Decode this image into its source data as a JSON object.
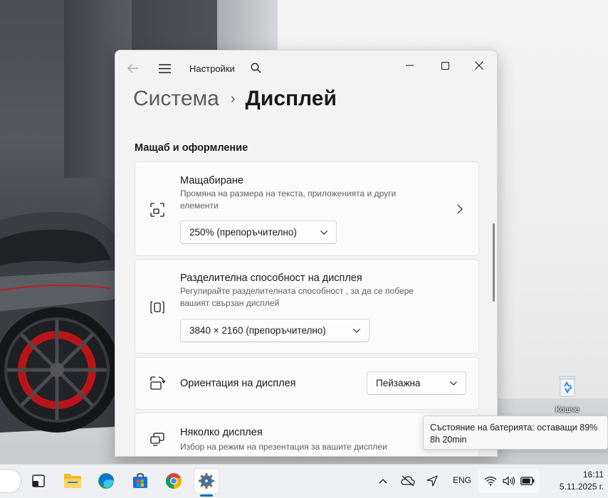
{
  "desktop": {
    "recycle_bin_label": "Кошче"
  },
  "window": {
    "app_title": "Настройки",
    "breadcrumb": {
      "parent": "Система",
      "separator": "›",
      "current": "Дисплей"
    },
    "section_title": "Мащаб и оформление",
    "cards": {
      "scale": {
        "title": "Мащабиране",
        "description": "Промяна на размера на текста, приложенията и други елементи",
        "value": "250% (препоръчително)"
      },
      "resolution": {
        "title": "Разделителна способност на дисплея",
        "description": "Регулирайте разделителната способност , за да се побере вашият свързан дисплей",
        "value": "3840 × 2160 (препоръчително)"
      },
      "orientation": {
        "title": "Ориентация на дисплея",
        "value": "Пейзажна"
      },
      "multiple": {
        "title": "Няколко дисплея",
        "description": "Избор на режим на презентация за вашите дисплеи"
      }
    }
  },
  "tooltip": {
    "line1": "Състояние на батерията: оставащи 89%",
    "line2": "8h 20min",
    "battery_percent": 89
  },
  "taskbar": {
    "apps": [
      "task-view",
      "file-explorer",
      "edge",
      "microsoft-store",
      "chrome",
      "settings"
    ],
    "active_app": "settings",
    "language": "ENG",
    "time": "16:11",
    "date": "5.11.2025 г.",
    "accent_color": "#0067c0"
  }
}
